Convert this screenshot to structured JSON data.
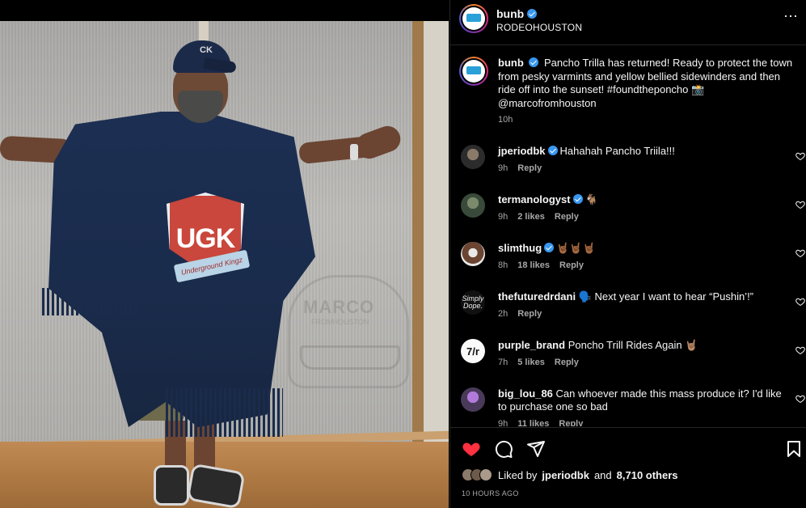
{
  "post": {
    "author": "bunb",
    "location": "RODEOHOUSTON",
    "more_label": "⋯",
    "caption": {
      "username": "bunb",
      "text": "Pancho Trilla has returned! Ready to protect the town from pesky varmints and yellow bellied sidewinders and then ride off into the sunset! #foundtheponcho 📸 @marcofromhouston",
      "time": "10h"
    },
    "comments": [
      {
        "username": "jperiodbk",
        "verified": true,
        "text": "Hahahah Pancho Triila!!!",
        "time": "9h",
        "likes": "",
        "reply": "Reply"
      },
      {
        "username": "termanologyst",
        "verified": true,
        "text": "🐐",
        "time": "9h",
        "likes": "2 likes",
        "reply": "Reply"
      },
      {
        "username": "slimthug",
        "verified": true,
        "text": "🤘🏾🤘🏾🤘🏾",
        "time": "8h",
        "likes": "18 likes",
        "reply": "Reply"
      },
      {
        "username": "thefuturedrdani",
        "verified": false,
        "text": "🗣️ Next year I want to hear “Pushin’!”",
        "time": "2h",
        "likes": "",
        "reply": "Reply"
      },
      {
        "username": "purple_brand",
        "verified": false,
        "text": "Poncho Trill Rides Again 🤘🏽",
        "time": "7h",
        "likes": "5 likes",
        "reply": "Reply"
      },
      {
        "username": "big_lou_86",
        "verified": false,
        "text": "Can whoever made this mass produce it? I'd like to purchase one so bad",
        "time": "9h",
        "likes": "11 likes",
        "reply": "Reply"
      }
    ],
    "avatar_texts": {
      "thefuturedrdani": "Simply Dope.",
      "purple_brand": "7/r"
    },
    "likes": {
      "prefix": "Liked by",
      "first": "jperiodbk",
      "joiner": "and",
      "others": "8,710 others"
    },
    "posted_ago": "10 HOURS AGO"
  },
  "photo": {
    "shield_text": "UGK",
    "shield_banner": "Underground Kingz",
    "cap_logo": "CK",
    "watermark": "MARCO",
    "watermark_sub": "FROMHOUSTON"
  },
  "icons": {
    "heart_filled_color": "#ff3040",
    "verified_color": "#3897f0"
  }
}
